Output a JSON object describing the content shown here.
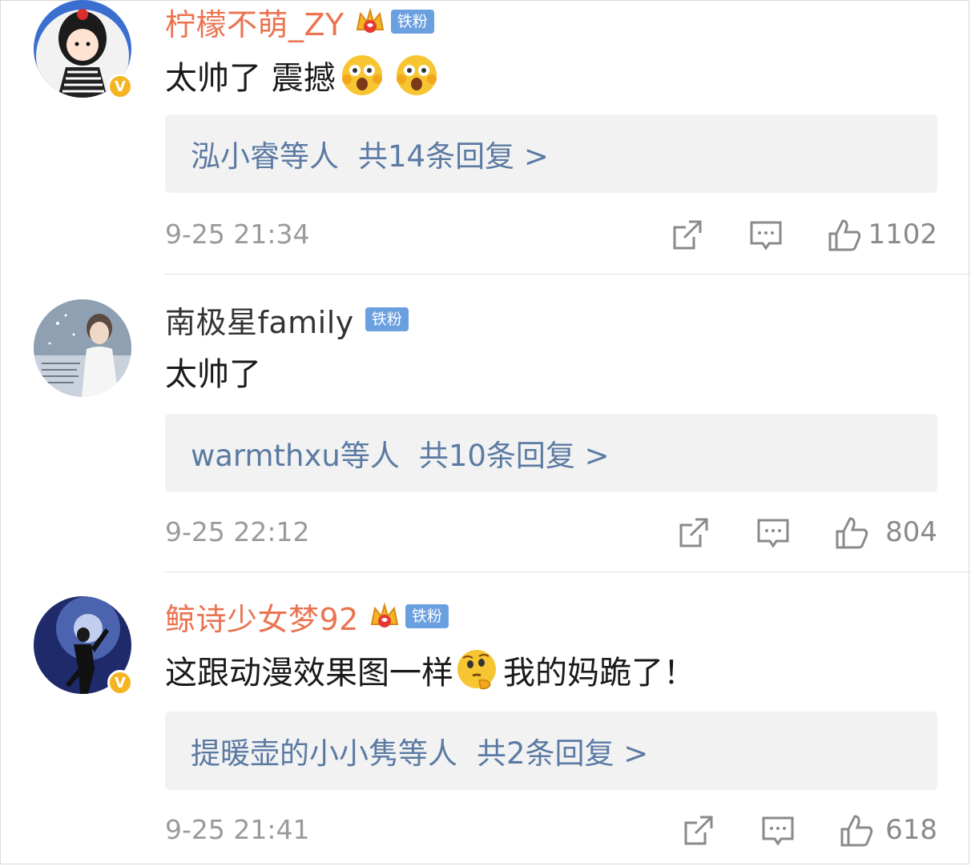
{
  "comments": [
    {
      "username": "柠檬不萌_ZY",
      "username_style": "vip",
      "has_crown": true,
      "fan_badge": "铁粉",
      "verified": true,
      "text": "太帅了 震撼",
      "emojis": [
        "surprised-emoji",
        "surprised-emoji"
      ],
      "reply_users": "泓小睿等人",
      "reply_count": "共14条回复 >",
      "time": "9-25 21:34",
      "likes": "1102"
    },
    {
      "username": "南极星family",
      "username_style": "normal",
      "has_crown": false,
      "fan_badge": "铁粉",
      "verified": false,
      "text": "太帅了",
      "emojis": [],
      "reply_users": "warmthxu等人",
      "reply_count": "共10条回复 >",
      "time": "9-25 22:12",
      "likes": "804"
    },
    {
      "username": "鲸诗少女梦92",
      "username_style": "vip",
      "has_crown": true,
      "fan_badge": "铁粉",
      "verified": true,
      "text": "这跟动漫效果图一样",
      "emojis": [
        "thinking-emoji"
      ],
      "text_after": "我的妈跪了！",
      "reply_users": "提暖壶的小小隽等人",
      "reply_count": "共2条回复 >",
      "time": "9-25 21:41",
      "likes": "618"
    }
  ],
  "icons": {
    "share": "share-icon",
    "comment": "comment-icon",
    "like": "thumbs-up-icon",
    "verified": "verified-v-icon",
    "crown": "crown-icon"
  },
  "colors": {
    "vip_name": "#eb7350",
    "reply_link": "#5b7aa3",
    "fan_badge": "#6a9fe0",
    "verified_badge": "#f5b523"
  }
}
